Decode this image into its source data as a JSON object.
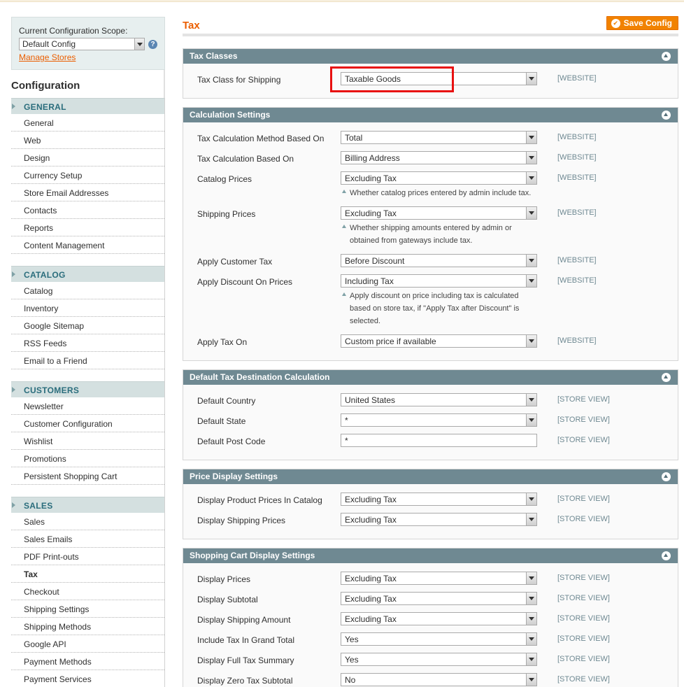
{
  "scope": {
    "label": "Current Configuration Scope:",
    "selected": "Default Config",
    "manage_link": "Manage Stores"
  },
  "sidebar": {
    "title": "Configuration",
    "groups": [
      {
        "head": "GENERAL",
        "items": [
          "General",
          "Web",
          "Design",
          "Currency Setup",
          "Store Email Addresses",
          "Contacts",
          "Reports",
          "Content Management"
        ]
      },
      {
        "head": "CATALOG",
        "items": [
          "Catalog",
          "Inventory",
          "Google Sitemap",
          "RSS Feeds",
          "Email to a Friend"
        ]
      },
      {
        "head": "CUSTOMERS",
        "items": [
          "Newsletter",
          "Customer Configuration",
          "Wishlist",
          "Promotions",
          "Persistent Shopping Cart"
        ]
      },
      {
        "head": "SALES",
        "items": [
          "Sales",
          "Sales Emails",
          "PDF Print-outs",
          "Tax",
          "Checkout",
          "Shipping Settings",
          "Shipping Methods",
          "Google API",
          "Payment Methods",
          "Payment Services"
        ]
      }
    ],
    "active_item": "Tax"
  },
  "header": {
    "title": "Tax",
    "save_label": "Save Config"
  },
  "sections": [
    {
      "title": "Tax Classes",
      "rows": [
        {
          "label": "Tax Class for Shipping",
          "type": "select",
          "value": "Taxable Goods",
          "scope": "[WEBSITE]",
          "highlighted": true
        }
      ]
    },
    {
      "title": "Calculation Settings",
      "rows": [
        {
          "label": "Tax Calculation Method Based On",
          "type": "select",
          "value": "Total",
          "scope": "[WEBSITE]"
        },
        {
          "label": "Tax Calculation Based On",
          "type": "select",
          "value": "Billing Address",
          "scope": "[WEBSITE]"
        },
        {
          "label": "Catalog Prices",
          "type": "select",
          "value": "Excluding Tax",
          "scope": "[WEBSITE]",
          "note": "Whether catalog prices entered by admin include tax."
        },
        {
          "label": "Shipping Prices",
          "type": "select",
          "value": "Excluding Tax",
          "scope": "[WEBSITE]",
          "note": "Whether shipping amounts entered by admin or obtained from gateways include tax."
        },
        {
          "label": "Apply Customer Tax",
          "type": "select",
          "value": "Before Discount",
          "scope": "[WEBSITE]"
        },
        {
          "label": "Apply Discount On Prices",
          "type": "select",
          "value": "Including Tax",
          "scope": "[WEBSITE]",
          "note": "Apply discount on price including tax is calculated based on store tax, if \"Apply Tax after Discount\" is selected."
        },
        {
          "label": "Apply Tax On",
          "type": "select",
          "value": "Custom price if available",
          "scope": "[WEBSITE]"
        }
      ]
    },
    {
      "title": "Default Tax Destination Calculation",
      "rows": [
        {
          "label": "Default Country",
          "type": "select",
          "value": "United States",
          "scope": "[STORE VIEW]"
        },
        {
          "label": "Default State",
          "type": "select",
          "value": "*",
          "scope": "[STORE VIEW]"
        },
        {
          "label": "Default Post Code",
          "type": "input",
          "value": "*",
          "scope": "[STORE VIEW]"
        }
      ]
    },
    {
      "title": "Price Display Settings",
      "rows": [
        {
          "label": "Display Product Prices In Catalog",
          "type": "select",
          "value": "Excluding Tax",
          "scope": "[STORE VIEW]"
        },
        {
          "label": "Display Shipping Prices",
          "type": "select",
          "value": "Excluding Tax",
          "scope": "[STORE VIEW]"
        }
      ]
    },
    {
      "title": "Shopping Cart Display Settings",
      "rows": [
        {
          "label": "Display Prices",
          "type": "select",
          "value": "Excluding Tax",
          "scope": "[STORE VIEW]"
        },
        {
          "label": "Display Subtotal",
          "type": "select",
          "value": "Excluding Tax",
          "scope": "[STORE VIEW]"
        },
        {
          "label": "Display Shipping Amount",
          "type": "select",
          "value": "Excluding Tax",
          "scope": "[STORE VIEW]"
        },
        {
          "label": "Include Tax In Grand Total",
          "type": "select",
          "value": "Yes",
          "scope": "[STORE VIEW]"
        },
        {
          "label": "Display Full Tax Summary",
          "type": "select",
          "value": "Yes",
          "scope": "[STORE VIEW]"
        },
        {
          "label": "Display Zero Tax Subtotal",
          "type": "select",
          "value": "No",
          "scope": "[STORE VIEW]"
        }
      ]
    }
  ],
  "colors": {
    "accent": "#eb5e00",
    "section_header": "#6f8992",
    "nav_header": "#d4e0e0",
    "highlight": "#e81010"
  }
}
